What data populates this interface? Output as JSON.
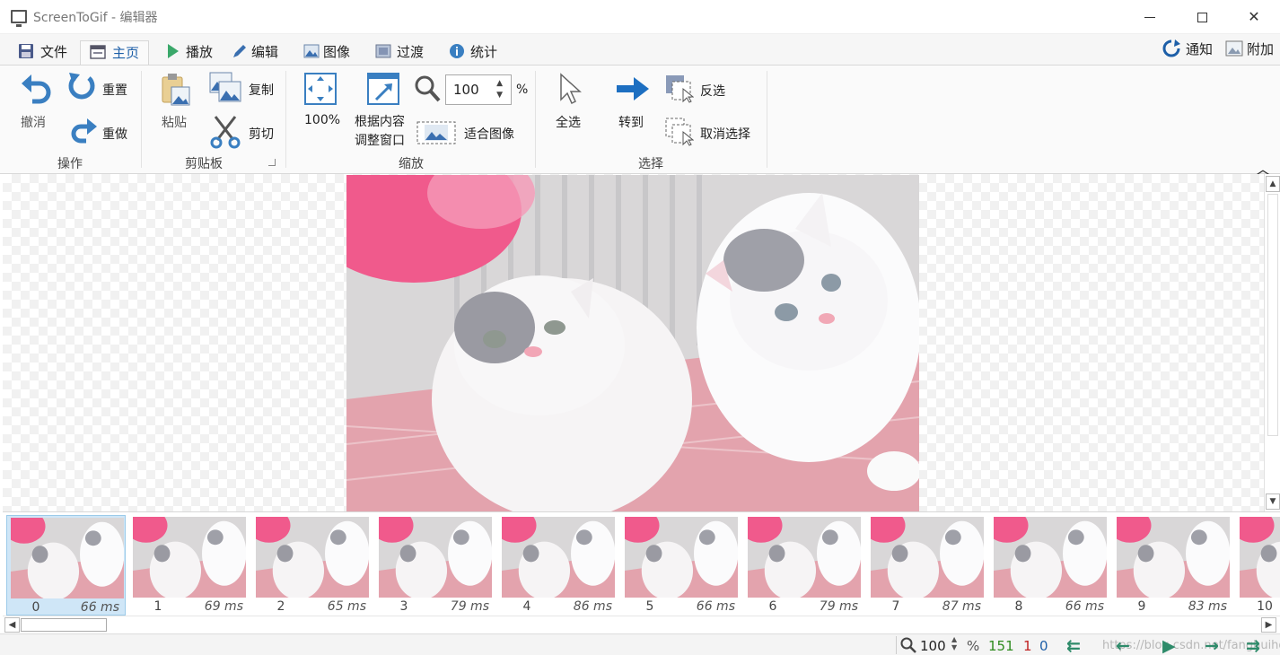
{
  "window": {
    "title": "ScreenToGif - 编辑器"
  },
  "tabs": [
    {
      "label": "文件",
      "icon": "save-icon"
    },
    {
      "label": "主页",
      "icon": "home-icon",
      "active": true
    },
    {
      "label": "播放",
      "icon": "play-icon"
    },
    {
      "label": "编辑",
      "icon": "pencil-icon"
    },
    {
      "label": "图像",
      "icon": "image-icon"
    },
    {
      "label": "过渡",
      "icon": "transition-icon"
    },
    {
      "label": "统计",
      "icon": "info-icon"
    }
  ],
  "tabs_right": {
    "notify": "通知",
    "extras": "附加"
  },
  "ribbon": {
    "actions": {
      "undo": "撤消",
      "reset": "重置",
      "redo": "重做",
      "group": "操作"
    },
    "clipboard": {
      "paste": "粘贴",
      "copy": "复制",
      "cut": "剪切",
      "group": "剪贴板"
    },
    "zoom": {
      "full": "100%",
      "fit_line1": "根据内容",
      "fit_line2": "调整窗口",
      "zoom_value": "100",
      "percent": "%",
      "fit_image": "适合图像",
      "group": "缩放"
    },
    "select": {
      "select_all": "全选",
      "goto": "转到",
      "invert": "反选",
      "deselect": "取消选择",
      "group": "选择"
    }
  },
  "frames": [
    {
      "index": "0",
      "delay": "66 ms"
    },
    {
      "index": "1",
      "delay": "69 ms"
    },
    {
      "index": "2",
      "delay": "65 ms"
    },
    {
      "index": "3",
      "delay": "79 ms"
    },
    {
      "index": "4",
      "delay": "86 ms"
    },
    {
      "index": "5",
      "delay": "66 ms"
    },
    {
      "index": "6",
      "delay": "79 ms"
    },
    {
      "index": "7",
      "delay": "87 ms"
    },
    {
      "index": "8",
      "delay": "66 ms"
    },
    {
      "index": "9",
      "delay": "83 ms"
    },
    {
      "index": "10",
      "delay": ""
    }
  ],
  "status": {
    "zoom": "100",
    "percent": "%",
    "total_frames": "151",
    "selected_count": "1",
    "current_index": "0",
    "watermark": "https://blog.csdn.net/fanghuiho"
  },
  "colors": {
    "accent": "#1d5fa8",
    "ribbon_icon": "#3a7fc1",
    "selected_thumb": "#cfe6f7"
  }
}
